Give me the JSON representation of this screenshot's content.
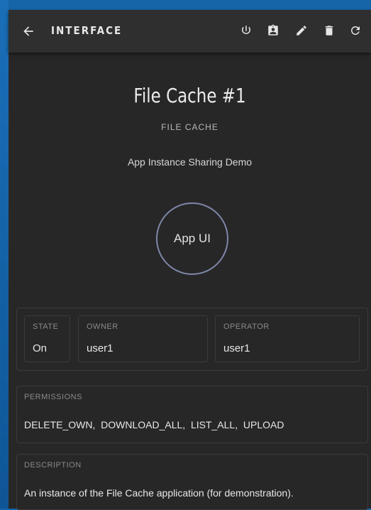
{
  "appbar": {
    "title": "INTERFACE",
    "icons": [
      "back-arrow-icon",
      "power-icon",
      "badge-icon",
      "edit-icon",
      "delete-icon",
      "refresh-icon"
    ]
  },
  "instance": {
    "title": "File Cache #1",
    "type": "FILE CACHE",
    "description": "App Instance Sharing Demo",
    "app_ui_label": "App UI"
  },
  "info": {
    "state_label": "STATE",
    "state_value": "On",
    "owner_label": "OWNER",
    "owner_value": "user1",
    "operator_label": "OPERATOR",
    "operator_value": "user1"
  },
  "permissions": {
    "label": "PERMISSIONS",
    "value": "DELETE_OWN,  DOWNLOAD_ALL,  LIST_ALL,  UPLOAD"
  },
  "description_card": {
    "label": "DESCRIPTION",
    "value": "An instance of the File Cache application (for demonstration)."
  },
  "colors": {
    "panel": "#272727",
    "appbar": "#2f2f2f",
    "frame": "#1565a8",
    "circle_border": "#7d86a8"
  }
}
